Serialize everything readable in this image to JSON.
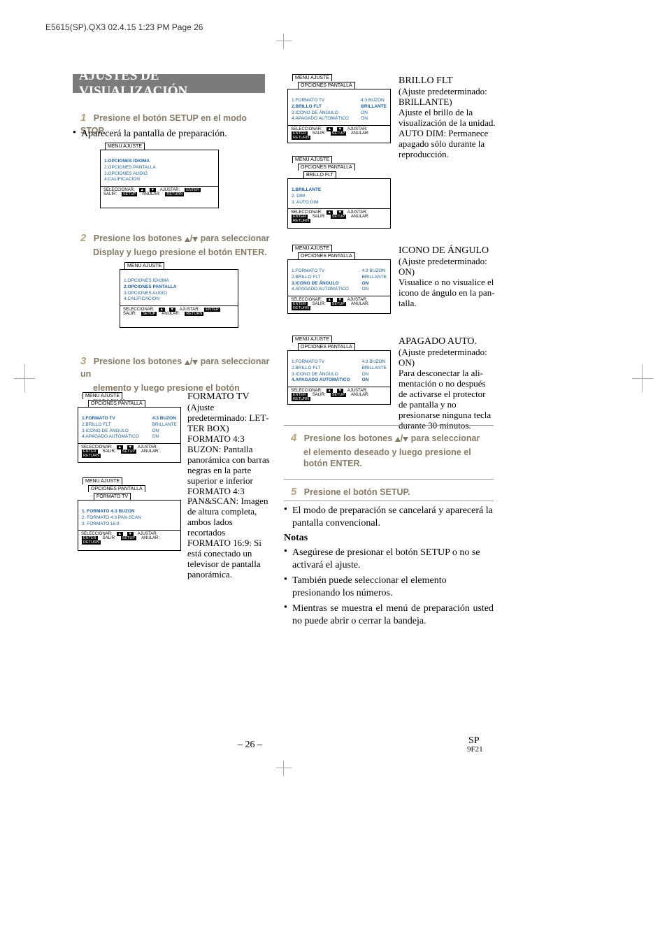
{
  "header": "E5615(SP).QX3  02.4.15 1:23 PM  Page 26",
  "title": "AJUSTES DE VISUALIZACIÓN",
  "steps": {
    "s1": {
      "num": "1",
      "text": "Presione el botón SETUP en el modo STOP."
    },
    "s1_after": "Aparecerá la pantalla de preparación.",
    "s2": {
      "num": "2",
      "text1": "Presione los botones ",
      "text2": " para seleccionar",
      "line2": "Display y luego presione el botón ENTER."
    },
    "s3": {
      "num": "3",
      "text1": "Presione los botones ",
      "text2": " para seleccionar un",
      "line2": "elemento y luego presione el botón ENTER."
    },
    "s4": {
      "num": "4",
      "text1": "Presione los botones ",
      "text2": " para seleccionar",
      "line2": "el elemento deseado y luego presione el",
      "line3": "botón ENTER."
    },
    "s5": {
      "num": "5",
      "text": "Presione el botón SETUP."
    },
    "s5_after": "El modo de preparación se cancelará y aparecerá la pantalla convencional."
  },
  "notes": {
    "title": "Notas",
    "n1": "Asegúrese de presionar el botón SETUP o no se acti­vará el ajuste.",
    "n2": "También puede seleccionar el elemento presionando los números.",
    "n3": "Mientras se muestra el menú de preparación usted no puede abrir o cerrar la bandeja."
  },
  "menus": {
    "tab_main": "MENU AJUSTE",
    "tab_opciones": "OPCIONES PANTALLA",
    "tab_brillo": "BRILLO FLT",
    "tab_formato": "FORMATO TV",
    "main_items": [
      "1.OPCIONES IDIOMA",
      "2.OPCIONES PANTALLA",
      "3.OPCIONES AUDIO",
      "4.CALIFICACION"
    ],
    "opciones_l": [
      "1.FORMATO TV",
      "2.BRILLO FLT",
      "3.ICONO DE ÁNGULO",
      "4.APAGADO AUTOMÁTICO"
    ],
    "opciones_r": [
      "4:3 BUZON",
      "BRILLANTE",
      "ON",
      "ON"
    ],
    "brillo_items": [
      "1.BRILLANTE",
      "2. DIM",
      "3. AUTO DIM"
    ],
    "formato_items": [
      "1.  FORMATO  4:3 BUZON",
      "2.  FORMATO  4:3 PAN-SCAN",
      "3.  FORMATO  16:9"
    ],
    "foot": {
      "sel": "SELECCIONAR:",
      "aj": "AJUSTAR:",
      "sal": "SALIR:",
      "anu": "ANULAR:",
      "enter": "ENTER",
      "setup": "SETUP",
      "return": "RETURN"
    }
  },
  "desc": {
    "formato": {
      "title": "FORMATO TV",
      "default": "(Ajuste predeterminado: LET­TER BOX)",
      "p1": "FORMATO 4:3 BUZON: Pantalla panorámica con bar­ras negras en la parte superior e inferior",
      "p2": "FORMATO 4:3 PAN&SCAN: Imagen de altura completa, ambos lados recortados",
      "p3": "FORMATO 16:9: Si está conectado un televisor de pantalla panorámica."
    },
    "brillo": {
      "title": "BRILLO FLT",
      "default": "(Ajuste predeterminado: BRILLANTE)",
      "p1": "Ajuste el brillo de la visual­ización de la unidad.",
      "p2": "AUTO DIM: Permanece apa­gado sólo durante la repro­ducción."
    },
    "angulo": {
      "title": "ICONO DE ÁNGULO",
      "default": "(Ajuste predeterminado: ON)",
      "p1": "Visualice o no visualice el icono de ángulo en la pan­talla."
    },
    "apagado": {
      "title": "APAGADO AUTO.",
      "default": "(Ajuste predeterminado: ON)",
      "p1": "Para desconectar la ali­mentación o no después de activarse el protector de pan­talla y no presionarse ninguna tecla durante 30 minutos."
    }
  },
  "footer": {
    "page": "– 26 –",
    "sp": "SP",
    "code": "9F21"
  }
}
